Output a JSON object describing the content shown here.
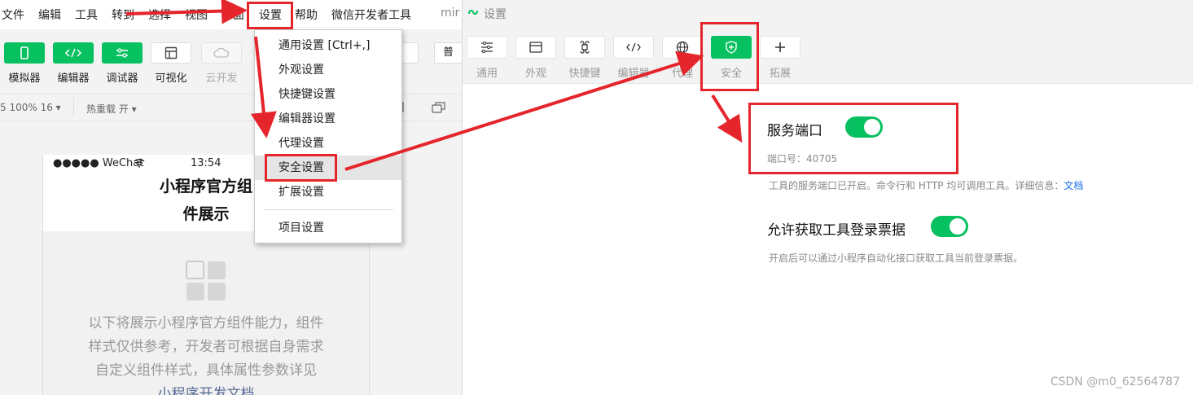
{
  "menubar": {
    "items": [
      "文件",
      "编辑",
      "工具",
      "转到",
      "选择",
      "视图",
      "界面",
      "设置",
      "帮助",
      "微信开发者工具"
    ],
    "overflow": "mir"
  },
  "toolbar": {
    "tools": [
      {
        "label": "模拟器",
        "icon": "phone-icon"
      },
      {
        "label": "编辑器",
        "icon": "code-icon"
      },
      {
        "label": "调试器",
        "icon": "debugger-icon"
      },
      {
        "label": "可视化",
        "icon": "layout-icon"
      },
      {
        "label": "云开发",
        "icon": "cloud-icon"
      }
    ],
    "mode_partial": "普通"
  },
  "statusbar": {
    "zoom": "5 100% 16 ▾",
    "hot_reload": "热重载 开 ▾"
  },
  "phone": {
    "status_left": "●●●●● WeChat",
    "time": "13:54",
    "title_line1": "小程序官方组",
    "title_line2": "件展示",
    "desc_line1": "以下将展示小程序官方组件能力，组件",
    "desc_line2": "样式仅供参考，开发者可根据自身需求",
    "desc_line3": "自定义组件样式，具体属性参数详见",
    "desc_link": "小程序开发文档"
  },
  "dropdown": {
    "items": [
      {
        "label": "通用设置  [Ctrl+,]"
      },
      {
        "label": "外观设置"
      },
      {
        "label": "快捷键设置"
      },
      {
        "label": "编辑器设置"
      },
      {
        "label": "代理设置"
      },
      {
        "label": "安全设置"
      },
      {
        "label": "扩展设置"
      },
      {
        "label": "项目设置"
      }
    ]
  },
  "settings": {
    "window_title": "设置",
    "tabs": [
      {
        "label": "通用",
        "icon": "sliders-icon"
      },
      {
        "label": "外观",
        "icon": "window-icon"
      },
      {
        "label": "快捷键",
        "icon": "command-icon"
      },
      {
        "label": "编辑器",
        "icon": "code-icon"
      },
      {
        "label": "代理",
        "icon": "globe-icon"
      },
      {
        "label": "安全",
        "icon": "shield-icon"
      },
      {
        "label": "拓展",
        "icon": "plus-icon"
      }
    ],
    "service_port": {
      "title": "服务端口",
      "enabled": true,
      "port_label": "端口号：40705",
      "desc": "工具的服务端口已开启。命令行和 HTTP 均可调用工具。详细信息：",
      "link": "文档"
    },
    "login_ticket": {
      "title": "允许获取工具登录票据",
      "enabled": true,
      "desc": "开启后可以通过小程序自动化接口获取工具当前登录票据。"
    }
  },
  "watermark": "CSDN @m0_62564787",
  "colors": {
    "accent": "#07c160",
    "annotation": "#e5252c",
    "link": "#576b95"
  }
}
